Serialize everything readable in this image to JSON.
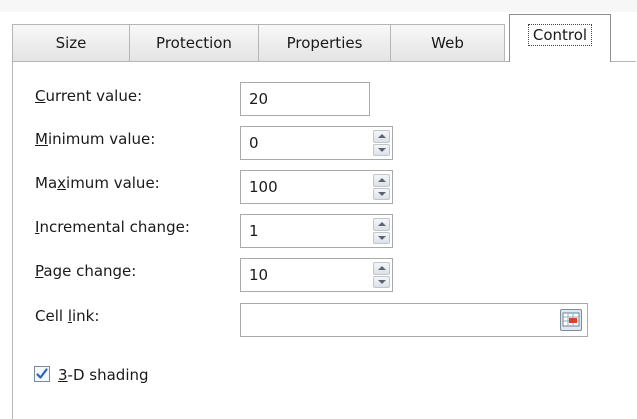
{
  "tabs": [
    {
      "label": "Size"
    },
    {
      "label": "Protection"
    },
    {
      "label": "Properties"
    },
    {
      "label": "Web"
    },
    {
      "label": "Control"
    }
  ],
  "active_tab": "Control",
  "fields": {
    "current_value": {
      "label_pre": "",
      "label_acc": "C",
      "label_post": "urrent value:",
      "value": "20"
    },
    "minimum_value": {
      "label_pre": "",
      "label_acc": "M",
      "label_post": "inimum value:",
      "value": "0"
    },
    "maximum_value": {
      "label_pre": "Ma",
      "label_acc": "x",
      "label_post": "imum value:",
      "value": "100"
    },
    "incremental_change": {
      "label_pre": "",
      "label_acc": "I",
      "label_post": "ncremental change:",
      "value": "1"
    },
    "page_change": {
      "label_pre": "",
      "label_acc": "P",
      "label_post": "age change:",
      "value": "10"
    },
    "cell_link": {
      "label_pre": "Cell ",
      "label_acc": "l",
      "label_post": "ink:",
      "value": ""
    }
  },
  "shading": {
    "label_pre": "",
    "label_acc": "3",
    "label_post": "-D shading",
    "checked": true
  },
  "icons": {
    "spin": "spinner-arrows-icon",
    "ref": "range-selector-icon",
    "check": "checkmark-icon"
  }
}
